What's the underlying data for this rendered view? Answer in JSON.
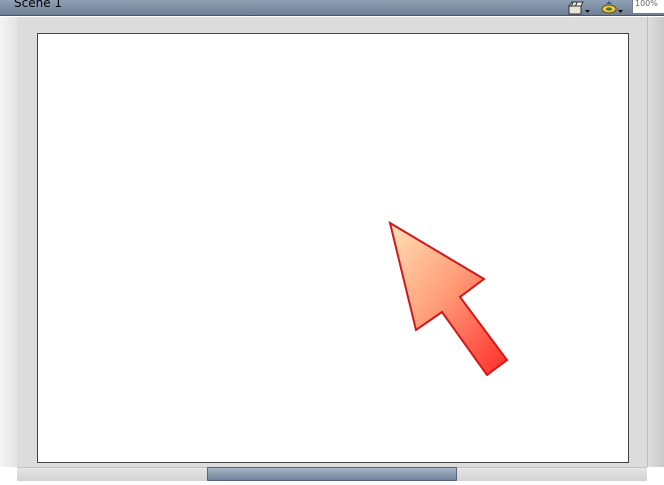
{
  "header": {
    "scene_label": "Scene 1",
    "zoom_value": "100%",
    "edit_scene_icon": "clapperboard-icon",
    "edit_symbol_icon": "shapes-icon"
  },
  "stage": {
    "background_color": "#ffffff",
    "graphic": {
      "type": "arrow",
      "pointing": "up-left",
      "fill_gradient": [
        "#ffd7a8",
        "#ff3a2a"
      ],
      "stroke_color": "#d21818"
    }
  },
  "colors": {
    "toolbar": "#7f8fa5",
    "work_area": "#dcdcdc",
    "scroll_thumb": "#8596ad"
  }
}
